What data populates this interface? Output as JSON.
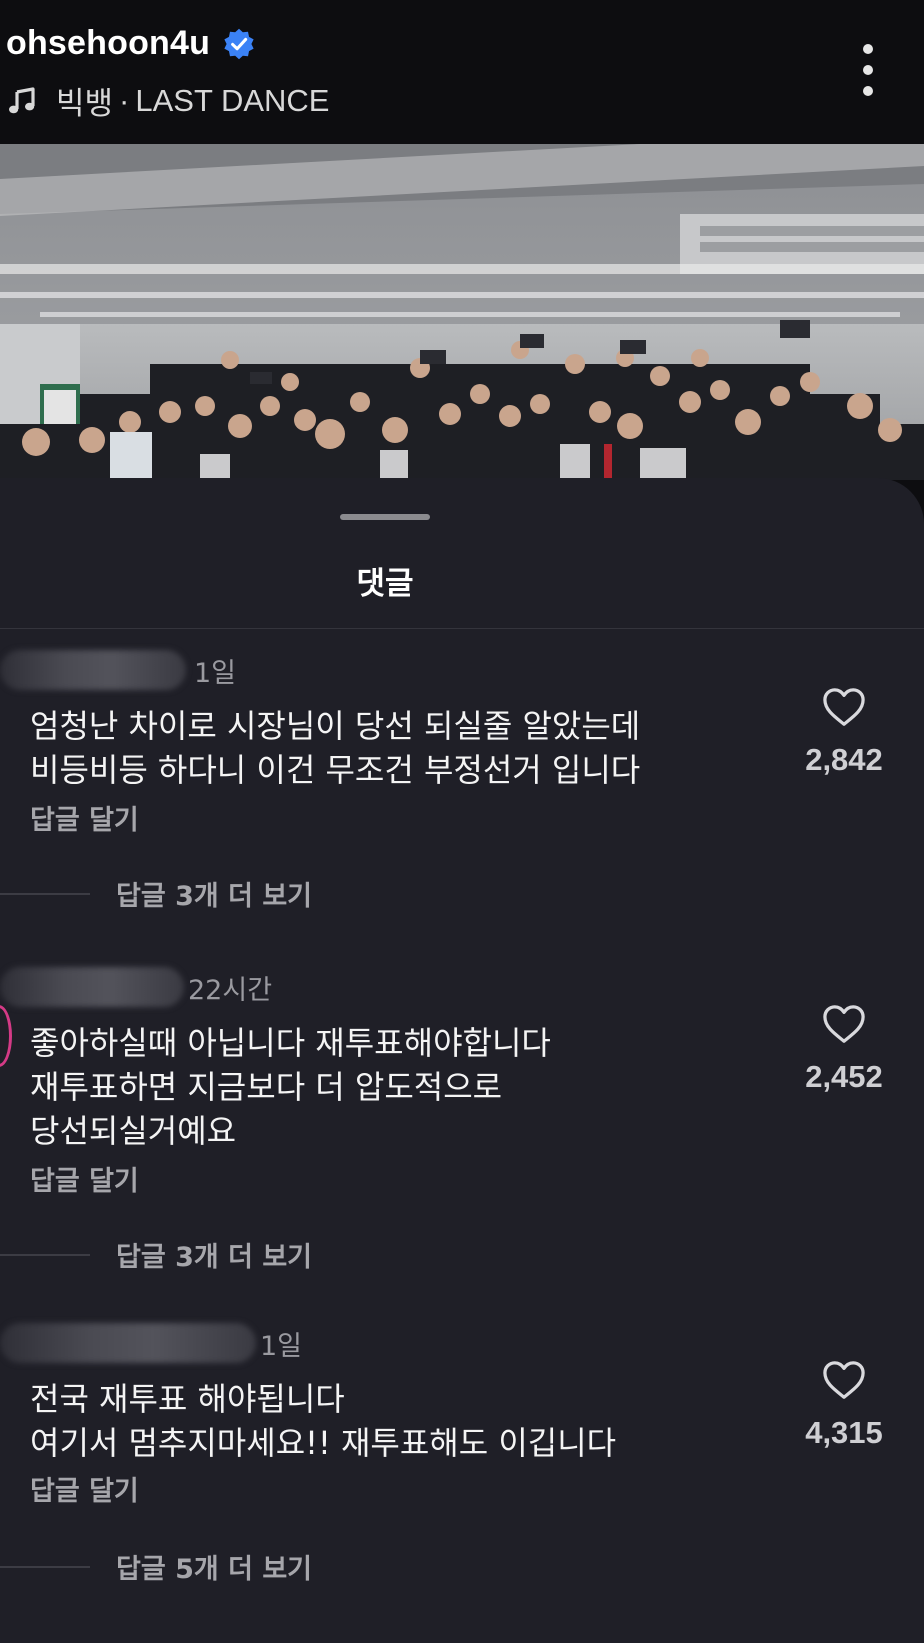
{
  "header": {
    "username": "ohsehoon4u",
    "music_artist": "빅뱅",
    "music_separator": "·",
    "music_title": "LAST DANCE"
  },
  "colors": {
    "background": "#0d0d10",
    "sheet": "#1f1f27",
    "verified": "#3b82f6",
    "story_ring": "#d43a86"
  },
  "icons": {
    "verified": "verified-badge-icon",
    "music": "music-note-icon",
    "more": "more-vertical-icon",
    "like": "heart-icon"
  },
  "sheet": {
    "title": "댓글"
  },
  "comments": [
    {
      "time": "1일",
      "lines": [
        "엄청난 차이로 시장님이 당선 되실줄 알았는데",
        "비등비등 하다니 이건 무조건 부정선거 입니다"
      ],
      "reply_label": "답글 달기",
      "more_replies": "답글 3개 더 보기",
      "likes": "2,842"
    },
    {
      "time": "22시간",
      "lines": [
        "좋아하실때 아닙니다 재투표해야합니다",
        "재투표하면 지금보다 더 압도적으로",
        "당선되실거예요"
      ],
      "reply_label": "답글 달기",
      "more_replies": "답글 3개 더 보기",
      "likes": "2,452"
    },
    {
      "time": "1일",
      "lines": [
        "전국 재투표 해야됩니다",
        "여기서 멈추지마세요!! 재투표해도 이깁니다"
      ],
      "reply_label": "답글 달기",
      "more_replies": "답글 5개 더 보기",
      "likes": "4,315"
    }
  ]
}
